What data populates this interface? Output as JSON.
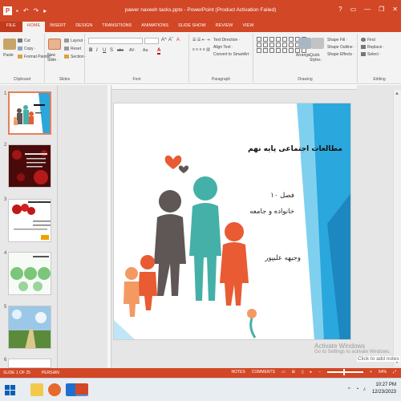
{
  "window": {
    "title": "pawer naveeh tacks.pptx - PowerPoint (Product Activation Failed)",
    "app_badge": "P",
    "controls": [
      "?",
      "▭",
      "—",
      "❐",
      "✕"
    ]
  },
  "ribbon_tabs": [
    "FILE",
    "HOME",
    "INSERT",
    "DESIGN",
    "TRANSITIONS",
    "ANIMATIONS",
    "SLIDE SHOW",
    "REVIEW",
    "VIEW"
  ],
  "ribbon": {
    "clipboard": {
      "paste": "Paste",
      "cut": "Cut",
      "copy": "Copy ·",
      "format_painter": "Format Painter",
      "label": "Clipboard"
    },
    "slides": {
      "new_slide": "New Slide ·",
      "layout": "Layout ·",
      "reset": "Reset",
      "section": "Section ·",
      "label": "Slides"
    },
    "font": {
      "label": "Font",
      "bold": "B",
      "italic": "I",
      "underline": "U",
      "strike": "S",
      "shadow": "abc",
      "spacing": "AV·",
      "case": "Aa·",
      "grow": "A^",
      "shrink": "Aˇ",
      "clear": "A",
      "color": "A"
    },
    "paragraph": {
      "text_direction": "Text Direction ·",
      "align_text": "Align Text ·",
      "smartart": "Convert to SmartArt ·",
      "label": "Paragraph"
    },
    "drawing": {
      "arrange": "Arrange",
      "quick_styles": "Quick Styles ·",
      "shape_fill": "Shape Fill ·",
      "shape_outline": "Shape Outline ·",
      "shape_effects": "Shape Effects ·",
      "label": "Drawing"
    },
    "editing": {
      "find": "Find",
      "replace": "Replace ·",
      "select": "Select ·",
      "label": "Editing"
    }
  },
  "thumbnails": [
    {
      "num": "1"
    },
    {
      "num": "2"
    },
    {
      "num": "3"
    },
    {
      "num": "4"
    },
    {
      "num": "5"
    },
    {
      "num": "6"
    }
  ],
  "slide": {
    "title": "مطالعات اجتماعی پایه نهم",
    "chapter": "فصل ۱۰",
    "subject": "خانواده و جامعه",
    "author": "وجیهه علیپور"
  },
  "watermark": {
    "line1": "Activate Windows",
    "line2": "Go to Settings to activate Windows."
  },
  "notes_hint": "Click to add notes",
  "status": {
    "slide_info": "SLIDE 1 OF 25",
    "language": "PERSIAN",
    "notes": "NOTES",
    "comments": "COMMENTS",
    "zoom": "64%"
  },
  "clock": {
    "time": "10:27 PM",
    "date": "12/23/2023"
  },
  "colors": {
    "accent": "#d24726",
    "slide_blue": "#2aa7dc",
    "figure_teal": "#45b0a8",
    "figure_gray": "#5f5656",
    "figure_orange": "#e85b33",
    "figure_peach": "#f39a63"
  }
}
